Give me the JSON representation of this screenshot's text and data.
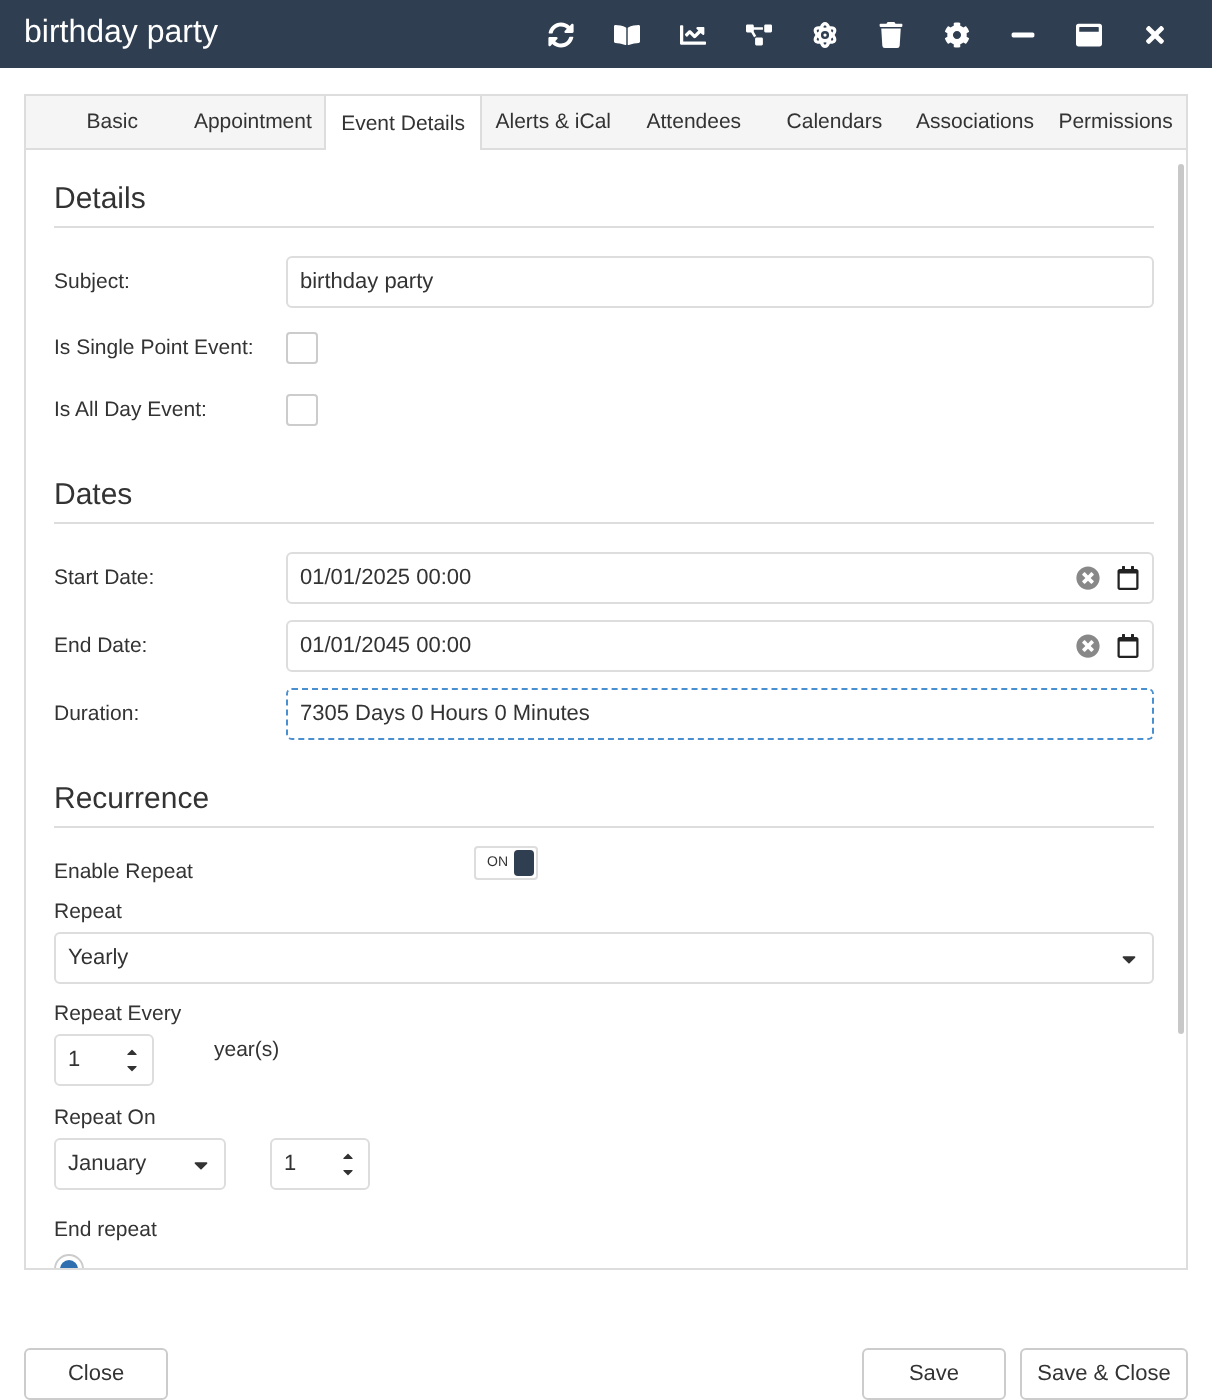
{
  "window": {
    "title": "birthday party"
  },
  "tabs": [
    {
      "label": "Basic",
      "selected": false
    },
    {
      "label": "Appointment",
      "selected": false
    },
    {
      "label": "Event Details",
      "selected": true
    },
    {
      "label": "Alerts & iCal",
      "selected": false
    },
    {
      "label": "Attendees",
      "selected": false
    },
    {
      "label": "Calendars",
      "selected": false
    },
    {
      "label": "Associations",
      "selected": false
    },
    {
      "label": "Permissions",
      "selected": false
    }
  ],
  "details": {
    "heading": "Details",
    "subject": {
      "label": "Subject:",
      "value": "birthday party"
    },
    "checkboxes": [
      {
        "label": "Is Single Point Event:",
        "checked": false
      },
      {
        "label": "Is All Day Event:",
        "checked": false
      }
    ]
  },
  "dates": {
    "heading": "Dates",
    "fields": [
      {
        "label": "Start Date:",
        "value": "01/01/2025 00:00",
        "kind": "date"
      },
      {
        "label": "End Date:",
        "value": "01/01/2045 00:00",
        "kind": "date"
      },
      {
        "label": "Duration:",
        "value": "7305 Days 0 Hours 0 Minutes",
        "kind": "focused"
      }
    ]
  },
  "recurrence": {
    "heading": "Recurrence",
    "enable": {
      "label": "Enable Repeat",
      "on": true,
      "toggle_text": "ON"
    },
    "repeat": {
      "label": "Repeat",
      "value": "Yearly"
    },
    "every": {
      "label": "Repeat Every",
      "value": "1",
      "unit": "year(s)"
    },
    "repeat_on": {
      "label": "Repeat On",
      "month": "January",
      "day": "1"
    },
    "end_repeat": {
      "label": "End repeat",
      "radio_selected": true
    }
  },
  "footer": {
    "left_buttons": [
      "Close"
    ],
    "right_buttons": [
      "Save",
      "Save & Close"
    ]
  }
}
